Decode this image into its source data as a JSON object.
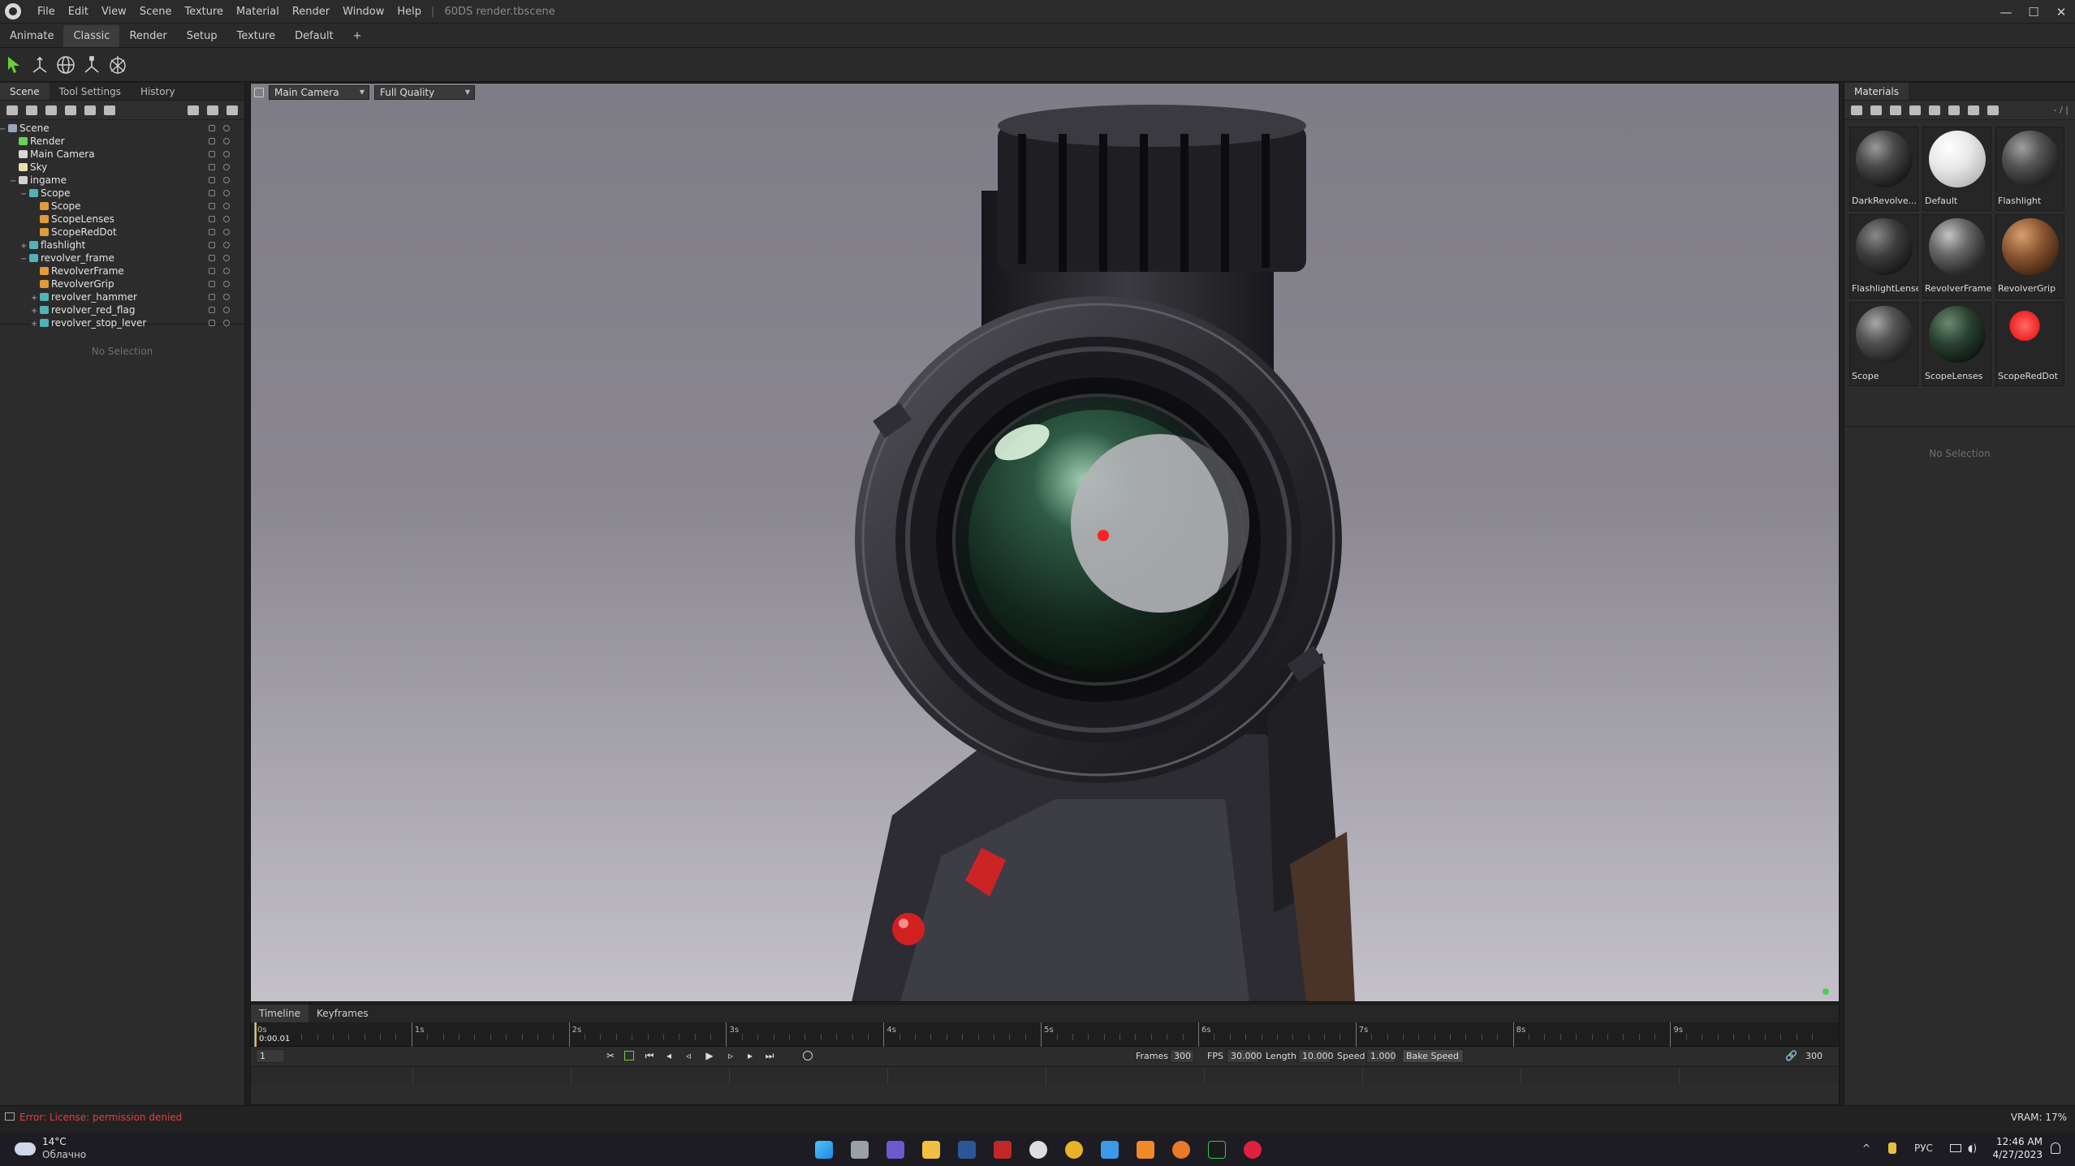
{
  "titlebar": {
    "menus": [
      "File",
      "Edit",
      "View",
      "Scene",
      "Texture",
      "Material",
      "Render",
      "Window",
      "Help"
    ],
    "separator": "|",
    "document": "60DS render.tbscene",
    "window_buttons": [
      "—",
      "☐",
      "✕"
    ]
  },
  "workspace_tabs": [
    "Animate",
    "Classic",
    "Render",
    "Setup",
    "Texture",
    "Default",
    "+"
  ],
  "active_workspace": "Classic",
  "left_panel": {
    "tabs": [
      "Scene",
      "Tool Settings",
      "History"
    ],
    "active_tab": "Scene",
    "tree": [
      {
        "label": "Scene",
        "depth": 0,
        "icon": "scene-icon",
        "color": "#9aa6b8",
        "expander": "−"
      },
      {
        "label": "Render",
        "depth": 1,
        "icon": "render-icon",
        "color": "#6ccf5a",
        "expander": ""
      },
      {
        "label": "Main Camera",
        "depth": 1,
        "icon": "camera-icon",
        "color": "#d8d8d8",
        "expander": ""
      },
      {
        "label": "Sky",
        "depth": 1,
        "icon": "sky-icon",
        "color": "#e8e0b0",
        "expander": ""
      },
      {
        "label": "ingame",
        "depth": 1,
        "icon": "mesh-icon",
        "color": "#d0d0d0",
        "expander": "−"
      },
      {
        "label": "Scope",
        "depth": 2,
        "icon": "group-icon",
        "color": "#4fb4b8",
        "expander": "−"
      },
      {
        "label": "Scope",
        "depth": 3,
        "icon": "material-icon",
        "color": "#e29a3a",
        "expander": ""
      },
      {
        "label": "ScopeLenses",
        "depth": 3,
        "icon": "material-icon",
        "color": "#e29a3a",
        "expander": ""
      },
      {
        "label": "ScopeRedDot",
        "depth": 3,
        "icon": "material-icon",
        "color": "#e29a3a",
        "expander": ""
      },
      {
        "label": "flashlight",
        "depth": 2,
        "icon": "group-icon",
        "color": "#4fb4b8",
        "expander": "+"
      },
      {
        "label": "revolver_frame",
        "depth": 2,
        "icon": "group-icon",
        "color": "#4fb4b8",
        "expander": "−"
      },
      {
        "label": "RevolverFrame",
        "depth": 3,
        "icon": "material-icon",
        "color": "#e29a3a",
        "expander": ""
      },
      {
        "label": "RevolverGrip",
        "depth": 3,
        "icon": "material-icon",
        "color": "#e29a3a",
        "expander": ""
      },
      {
        "label": "revolver_hammer",
        "depth": 3,
        "icon": "group-icon",
        "color": "#4fb4b8",
        "expander": "+"
      },
      {
        "label": "revolver_red_flag",
        "depth": 3,
        "icon": "group-icon",
        "color": "#4fb4b8",
        "expander": "+"
      },
      {
        "label": "revolver_stop_lever",
        "depth": 3,
        "icon": "group-icon",
        "color": "#4fb4b8",
        "expander": "+"
      }
    ],
    "no_selection": "No Selection"
  },
  "viewport": {
    "camera": "Main Camera",
    "quality": "Full Quality"
  },
  "timeline": {
    "tabs": [
      "Timeline",
      "Keyframes"
    ],
    "active_tab": "Timeline",
    "current_time": "0:00.01",
    "ticks": [
      "0s",
      "1s",
      "2s",
      "3s",
      "4s",
      "5s",
      "6s",
      "7s",
      "8s",
      "9s"
    ],
    "frame_field": "1",
    "frames_label": "Frames",
    "frames_value": "300",
    "fps_label": "FPS",
    "fps_value": "30.000",
    "length_label": "Length",
    "length_value": "10.000",
    "speed_label": "Speed",
    "speed_value": "1.000",
    "bake_label": "Bake Speed",
    "end_frame": "300"
  },
  "materials": {
    "title": "Materials",
    "zoom": "- / |",
    "items": [
      {
        "name": "DarkRevolve...",
        "style": "radial-gradient(circle at 35% 30%,#9a9a9a 0%,#4a4a4a 35%,#1e1e1e 70%,#0c0c0c 100%)"
      },
      {
        "name": "Default",
        "style": "radial-gradient(circle at 35% 30%,#ffffff 0%,#e8e8e8 40%,#b8b8b8 80%,#8a8a8a 100%)"
      },
      {
        "name": "Flashlight",
        "style": "radial-gradient(circle at 35% 30%,#a0a0a0 0%,#555 35%,#262626 70%,#111 100%)"
      },
      {
        "name": "FlashlightLense",
        "style": "radial-gradient(circle at 35% 30%,#8a8a8a 0%,#3c3c3c 40%,#1a1a1a 75%,#0a0a0a 100%)"
      },
      {
        "name": "RevolverFrame",
        "style": "radial-gradient(circle at 35% 30%,#c4c4c4 0%,#6a6a6a 35%,#2e2e2e 70%,#141414 100%)"
      },
      {
        "name": "RevolverGrip",
        "style": "radial-gradient(circle at 35% 30%,#d8a070 0%,#8a5530 40%,#4a2a14 75%,#1e0e06 100%)"
      },
      {
        "name": "Scope",
        "style": "radial-gradient(circle at 35% 30%,#a8a8a8 0%,#555 35%,#262626 70%,#101010 100%)"
      },
      {
        "name": "ScopeLenses",
        "style": "radial-gradient(circle at 35% 30%,#6a8a70 0%,#2a4030 40%,#101a14 75%,#050805 100%)"
      },
      {
        "name": "ScopeRedDot",
        "style": "radial-gradient(circle at 40% 35%,#ff6a6a 0%,#ee2222 30%,#c00000 18%,#262626 19%,#262626 100%)"
      }
    ],
    "no_selection": "No Selection"
  },
  "status": {
    "error": "Error: License: permission denied",
    "vram": "VRAM: 17%"
  },
  "taskbar": {
    "weather_temp": "14°C",
    "weather_desc": "Облачно",
    "lang": "РУС",
    "time": "12:46 AM",
    "date": "4/27/2023"
  }
}
